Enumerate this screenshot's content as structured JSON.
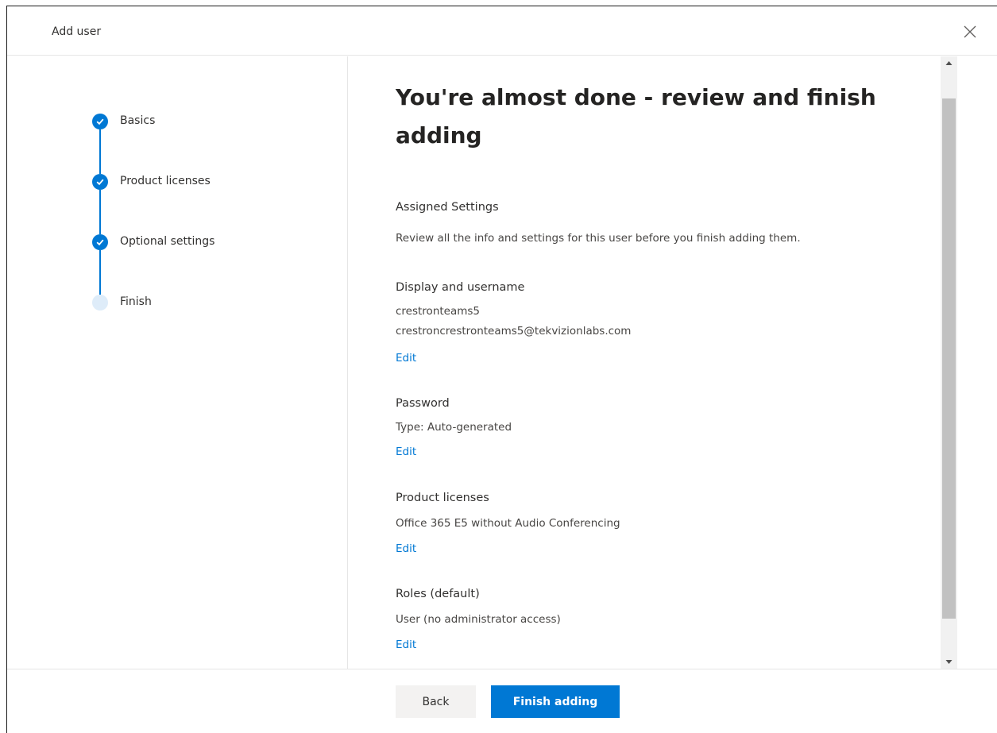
{
  "dialog": {
    "title": "Add user"
  },
  "steps": [
    {
      "label": "Basics",
      "status": "done"
    },
    {
      "label": "Product licenses",
      "status": "done"
    },
    {
      "label": "Optional settings",
      "status": "done"
    },
    {
      "label": "Finish",
      "status": "current"
    }
  ],
  "main": {
    "title": "You're almost done - review and finish adding",
    "assigned_title": "Assigned Settings",
    "assigned_desc": "Review all the info and settings for this user before you finish adding them.",
    "sections": [
      {
        "title": "Display and username",
        "lines": [
          "crestronteams5",
          "crestroncrestronteams5@tekvizionlabs.com"
        ],
        "edit": "Edit"
      },
      {
        "title": "Password",
        "lines": [
          "Type: Auto-generated"
        ],
        "edit": "Edit"
      },
      {
        "title": "Product licenses",
        "lines": [
          "Office 365 E5 without Audio Conferencing"
        ],
        "edit": "Edit"
      },
      {
        "title": "Roles (default)",
        "lines": [
          "User (no administrator access)"
        ],
        "edit": "Edit"
      }
    ]
  },
  "footer": {
    "back_label": "Back",
    "finish_label": "Finish adding"
  },
  "colors": {
    "accent": "#0078d4",
    "pending_step": "#deecf9"
  }
}
